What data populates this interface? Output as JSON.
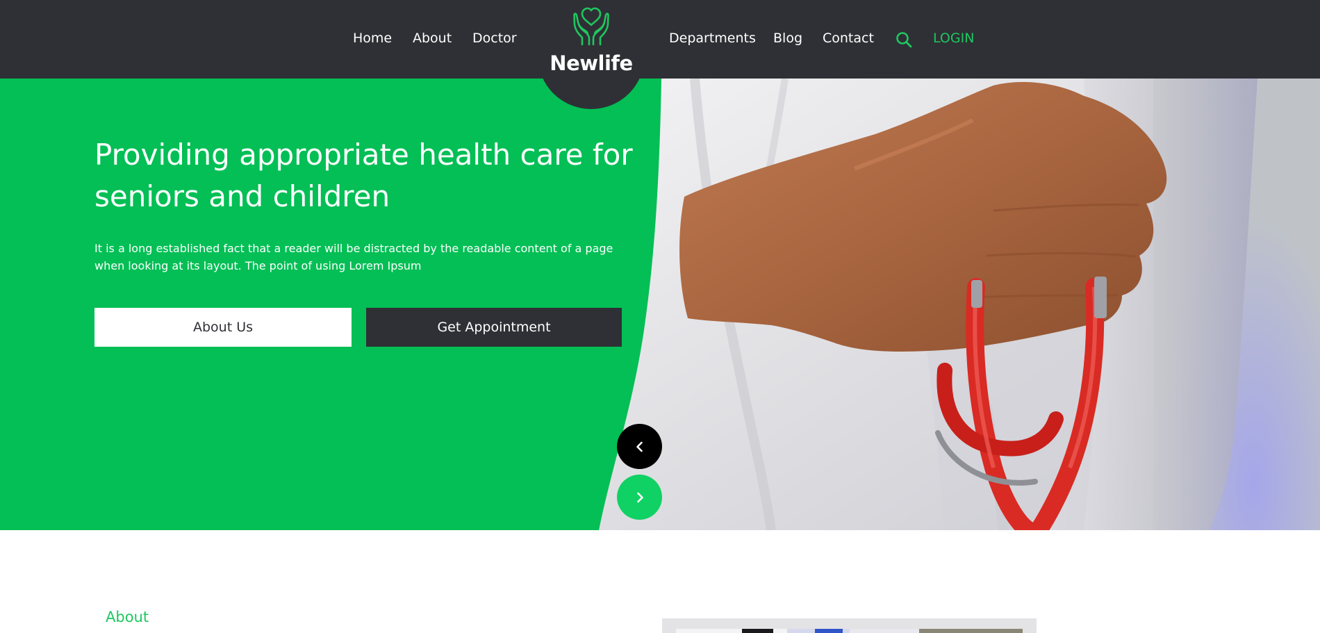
{
  "nav": {
    "left": [
      "Home",
      "About",
      "Doctor"
    ],
    "right": [
      "Departments",
      "Blog",
      "Contact"
    ],
    "login": "LOGIN",
    "search_icon": "search-icon"
  },
  "brand": {
    "name": "Newlife",
    "icon": "heart-hands-icon"
  },
  "hero": {
    "title": "Providing appropriate health care for seniors and children",
    "text": "It is a long established fact that a reader will be distracted by the readable content of a page when looking at its layout. The point of using Lorem Ipsum",
    "buttons": {
      "about": "About Us",
      "appointment": "Get Appointment"
    },
    "prev_icon": "chevron-left-icon",
    "next_icon": "chevron-right-icon"
  },
  "about": {
    "label": "About"
  },
  "colors": {
    "dark": "#2f3035",
    "green": "#03bf55",
    "accent": "#1ec760",
    "white": "#ffffff"
  }
}
